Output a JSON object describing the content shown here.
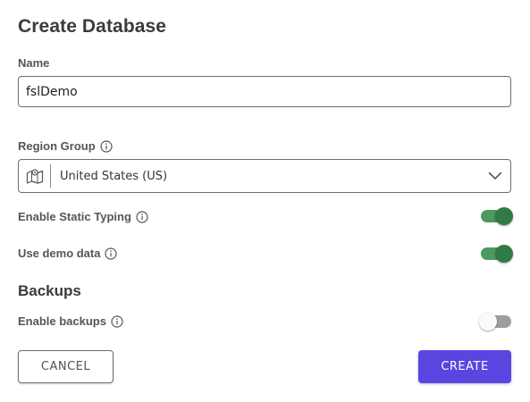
{
  "dialog": {
    "title": "Create Database"
  },
  "name_field": {
    "label": "Name",
    "value": "fslDemo"
  },
  "region_group": {
    "label": "Region Group",
    "selected": "United States (US)",
    "icon": "map-icon"
  },
  "static_typing": {
    "label": "Enable Static Typing",
    "enabled": true
  },
  "demo_data": {
    "label": "Use demo data",
    "enabled": true
  },
  "backups": {
    "section_title": "Backups",
    "label": "Enable backups",
    "enabled": false
  },
  "actions": {
    "cancel_label": "CANCEL",
    "create_label": "CREATE"
  },
  "colors": {
    "accent": "#5b45e0",
    "toggle_on": "#2f7a45",
    "toggle_off": "#9e9e9e"
  }
}
